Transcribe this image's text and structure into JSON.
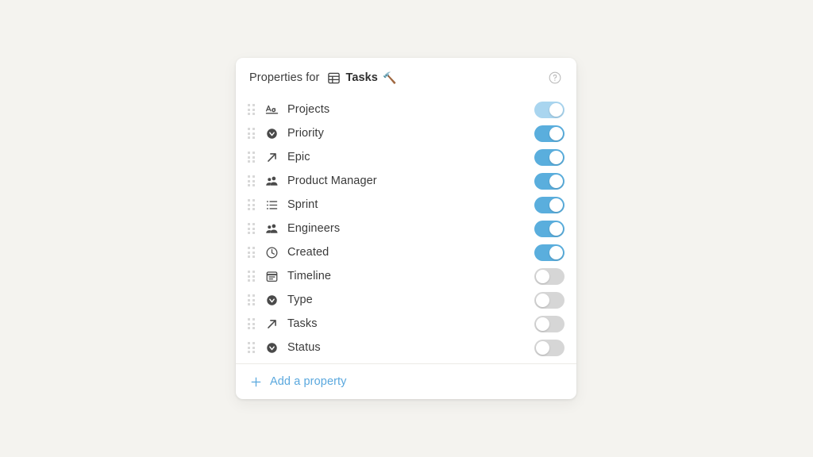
{
  "theme": {
    "page_background": "#f4f3ef",
    "card_background": "#ffffff",
    "accent": "#5aa8de",
    "toggle_on": "#5aaedd",
    "toggle_locked": "#a9d5ef",
    "toggle_off": "#d6d6d6",
    "text": "#3a3a3a"
  },
  "header": {
    "prefix": "Properties for",
    "database_icon": "table-database-icon",
    "database_name": "Tasks",
    "emoji": "🔨",
    "help_icon": "help-circle-icon"
  },
  "properties": [
    {
      "label": "Projects",
      "icon": "text-aa-icon",
      "icon_name": "text-property-icon",
      "enabled": true,
      "locked": true
    },
    {
      "label": "Priority",
      "icon": "select-icon",
      "icon_name": "select-property-icon",
      "enabled": true,
      "locked": false
    },
    {
      "label": "Epic",
      "icon": "relation-icon",
      "icon_name": "relation-property-icon",
      "enabled": true,
      "locked": false
    },
    {
      "label": "Product Manager",
      "icon": "person-icon",
      "icon_name": "person-property-icon",
      "enabled": true,
      "locked": false
    },
    {
      "label": "Sprint",
      "icon": "list-icon",
      "icon_name": "list-property-icon",
      "enabled": true,
      "locked": false
    },
    {
      "label": "Engineers",
      "icon": "person-icon",
      "icon_name": "person-property-icon",
      "enabled": true,
      "locked": false
    },
    {
      "label": "Created",
      "icon": "clock-icon",
      "icon_name": "clock-property-icon",
      "enabled": true,
      "locked": false
    },
    {
      "label": "Timeline",
      "icon": "calendar-icon",
      "icon_name": "date-property-icon",
      "enabled": false,
      "locked": false
    },
    {
      "label": "Type",
      "icon": "select-icon",
      "icon_name": "select-property-icon",
      "enabled": false,
      "locked": false
    },
    {
      "label": "Tasks",
      "icon": "relation-icon",
      "icon_name": "relation-property-icon",
      "enabled": false,
      "locked": false
    },
    {
      "label": "Status",
      "icon": "select-icon",
      "icon_name": "select-property-icon",
      "enabled": false,
      "locked": false
    }
  ],
  "footer": {
    "add_label": "Add a property",
    "add_icon": "plus-icon"
  }
}
